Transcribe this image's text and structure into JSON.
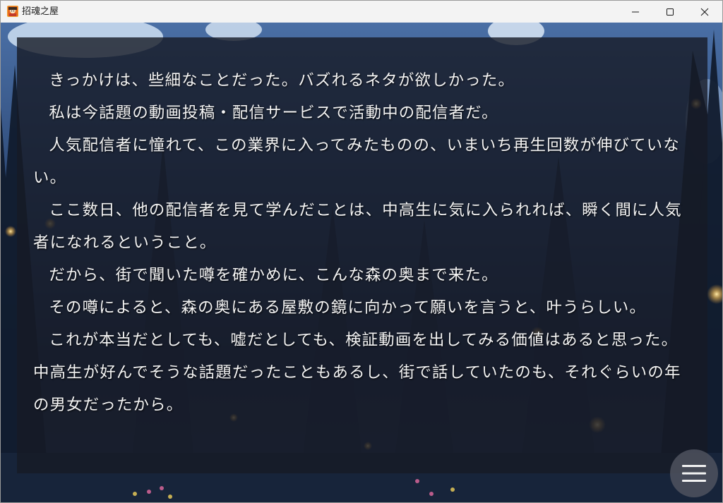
{
  "window": {
    "title": "招魂之屋",
    "app_icon": "game-app-icon"
  },
  "controls": {
    "minimize_icon": "minimize-icon",
    "maximize_icon": "maximize-icon",
    "close_icon": "close-icon"
  },
  "story": {
    "paragraphs": [
      "きっかけは、些細なことだった。バズれるネタが欲しかった。",
      "私は今話題の動画投稿・配信サービスで活動中の配信者だ。",
      "人気配信者に憧れて、この業界に入ってみたものの、いまいち再生回数が伸びていない。",
      "ここ数日、他の配信者を見て学んだことは、中高生に気に入られれば、瞬く間に人気者になれるということ。",
      "だから、街で聞いた噂を確かめに、こんな森の奥まで来た。",
      "その噂によると、森の奥にある屋敷の鏡に向かって願いを言うと、叶うらしい。",
      "これが本当だとしても、嘘だとしても、検証動画を出してみる価値はあると思った。中高生が好んでそうな話題だったこともあるし、街で話していたのも、それぐらいの年の男女だったから。"
    ]
  },
  "menu": {
    "icon": "hamburger-menu-icon"
  },
  "colors": {
    "titlebar": "#f3f3f3",
    "message_box": "#161a26",
    "text": "#f4f4f4",
    "sky": "#2e4a78",
    "menu_button": "#505460"
  }
}
